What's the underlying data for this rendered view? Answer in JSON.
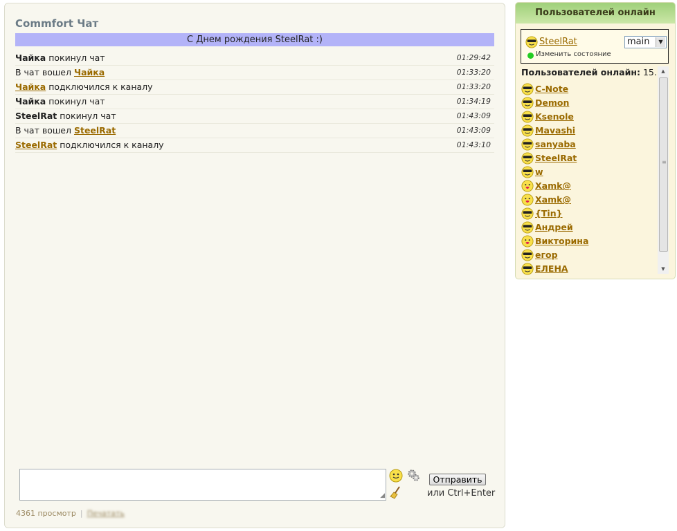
{
  "chat": {
    "title": "Commfort Чат",
    "banner": "С Днем рождения SteelRat :)",
    "messages": [
      {
        "pre": "",
        "name": "Чайка",
        "name_link": false,
        "post": " покинул чат",
        "time": "01:29:42"
      },
      {
        "pre": "В чат вошел ",
        "name": "Чайка",
        "name_link": true,
        "post": "",
        "time": "01:33:20"
      },
      {
        "pre": "",
        "name": "Чайка",
        "name_link": true,
        "post": " подключился к каналу",
        "time": "01:33:20"
      },
      {
        "pre": "",
        "name": "Чайка",
        "name_link": false,
        "post": " покинул чат",
        "time": "01:34:19"
      },
      {
        "pre": "",
        "name": "SteelRat",
        "name_link": false,
        "post": " покинул чат",
        "time": "01:43:09"
      },
      {
        "pre": "В чат вошел ",
        "name": "SteelRat",
        "name_link": true,
        "post": "",
        "time": "01:43:09"
      },
      {
        "pre": "",
        "name": "SteelRat",
        "name_link": true,
        "post": " подключился к каналу",
        "time": "01:43:10"
      }
    ],
    "input_value": "",
    "send_label": "Отправить",
    "hint": "или Ctrl+Enter",
    "icons": {
      "smiley": "smiley-icon",
      "settings": "gears-icon",
      "clear": "broom-icon"
    }
  },
  "footer": {
    "views": "4361 просмотр",
    "separator": "|",
    "link": "Печатать"
  },
  "sidebar": {
    "header": "Пользователей онлайн",
    "me": {
      "name": "SteelRat",
      "channel": "main",
      "status_label": "Изменить состояние",
      "status_color": "#22cc22"
    },
    "online_label": "Пользователей онлайн:",
    "online_count": "15.",
    "users": [
      {
        "name": "C-Note",
        "icon": "cool"
      },
      {
        "name": "Demon",
        "icon": "cool"
      },
      {
        "name": "Ksenole",
        "icon": "cool"
      },
      {
        "name": "Mavashi",
        "icon": "cool"
      },
      {
        "name": "sanyaba",
        "icon": "cool"
      },
      {
        "name": "SteelRat",
        "icon": "cool"
      },
      {
        "name": "w",
        "icon": "cool"
      },
      {
        "name": "Xamk@",
        "icon": "kiss"
      },
      {
        "name": "Xamk@",
        "icon": "kiss"
      },
      {
        "name": "{Tin}",
        "icon": "cool"
      },
      {
        "name": "Андрей",
        "icon": "cool"
      },
      {
        "name": "Викторина",
        "icon": "kiss"
      },
      {
        "name": "егор",
        "icon": "cool"
      },
      {
        "name": "ЕЛЕНА",
        "icon": "cool"
      }
    ]
  },
  "colors": {
    "link": "#9a6a00",
    "banner": "#b3b3f8",
    "panel_bg": "#f8f7ef",
    "sidebar_bg": "#fbf5dd",
    "header_green": "#9fd07a"
  }
}
